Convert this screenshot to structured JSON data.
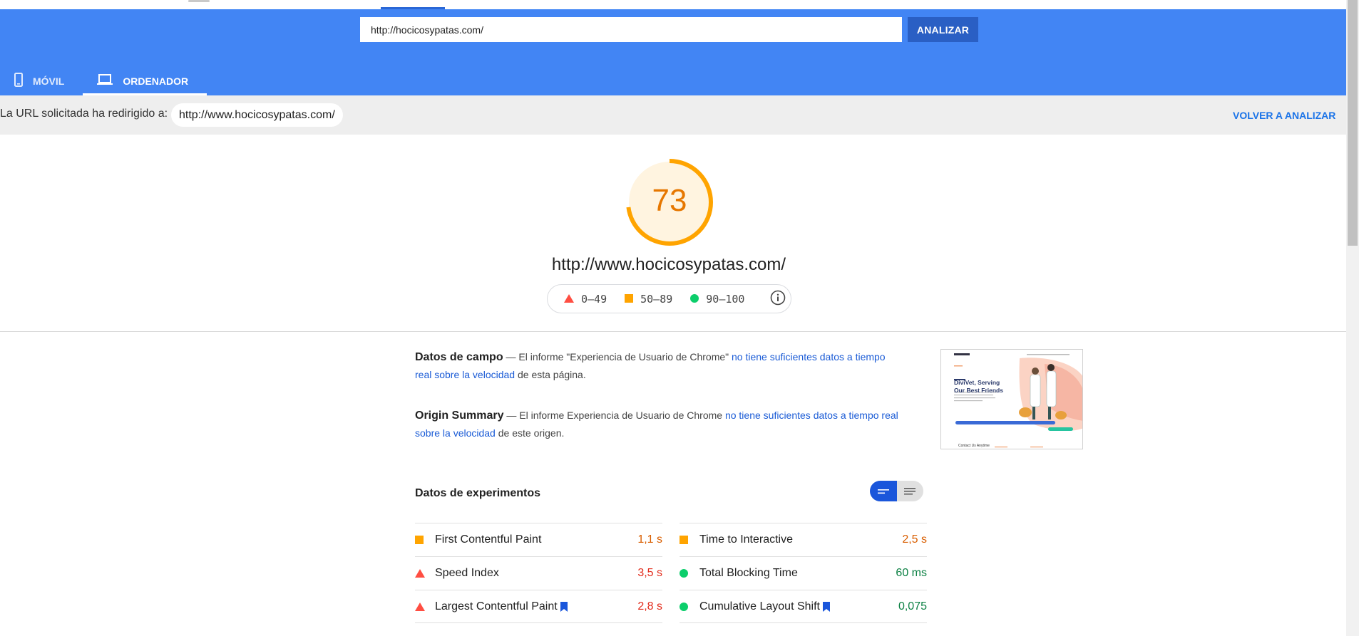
{
  "header": {
    "url_value": "http://hocicosypatas.com/",
    "analyze_label": "ANALIZAR",
    "tabs": [
      {
        "label": "MÓVIL",
        "icon": "mobile-icon",
        "active": false
      },
      {
        "label": "ORDENADOR",
        "icon": "laptop-icon",
        "active": true
      }
    ]
  },
  "redirect": {
    "text": "La URL solicitada ha redirigido a:",
    "url": "http://www.hocicosypatas.com/",
    "reanalyze_label": "VOLVER A ANALIZAR"
  },
  "score": {
    "value": "73",
    "fraction": 0.73,
    "url": "http://www.hocicosypatas.com/",
    "color": "#ffa400",
    "legend": [
      {
        "range": "0–49",
        "icon": "red-triangle-icon",
        "color": "#ff4e42"
      },
      {
        "range": "50–89",
        "icon": "orange-square-icon",
        "color": "#ffa400"
      },
      {
        "range": "90–100",
        "icon": "green-circle-icon",
        "color": "#0cce6b"
      }
    ]
  },
  "field_data": {
    "title": "Datos de campo",
    "text_before": " — El informe \"Experiencia de Usuario de Chrome\" ",
    "link": "no tiene suficientes datos a tiempo real sobre la velocidad",
    "text_after": " de esta página."
  },
  "origin_summary": {
    "title": "Origin Summary",
    "text_before": " — El informe Experiencia de Usuario de Chrome ",
    "link": "no tiene suficientes datos a tiempo real sobre la velocidad",
    "text_after": " de este origen."
  },
  "thumbnail": {
    "heading_line1": "DiviVet, Serving",
    "heading_line2": "Our Best Friends",
    "footer_text": "Contact Us Anytime"
  },
  "lab": {
    "title": "Datos de experimentos",
    "metrics": [
      {
        "name": "First Contentful Paint",
        "value": "1,1 s",
        "rating": "average",
        "flag": false
      },
      {
        "name": "Time to Interactive",
        "value": "2,5 s",
        "rating": "average",
        "flag": false
      },
      {
        "name": "Speed Index",
        "value": "3,5 s",
        "rating": "fail",
        "flag": false
      },
      {
        "name": "Total Blocking Time",
        "value": "60 ms",
        "rating": "pass",
        "flag": false
      },
      {
        "name": "Largest Contentful Paint",
        "value": "2,8 s",
        "rating": "fail",
        "flag": true
      },
      {
        "name": "Cumulative Layout Shift",
        "value": "0,075",
        "rating": "pass",
        "flag": true
      }
    ]
  },
  "colors": {
    "header_blue": "#4285f4",
    "button_blue": "#2a5fc4",
    "link_blue": "#1a5bd6",
    "fail": "#ff4e42",
    "average": "#ffa400",
    "pass": "#0cce6b",
    "fail_text": "#e22a1a",
    "average_text": "#d95e00",
    "pass_text": "#0b8043"
  }
}
